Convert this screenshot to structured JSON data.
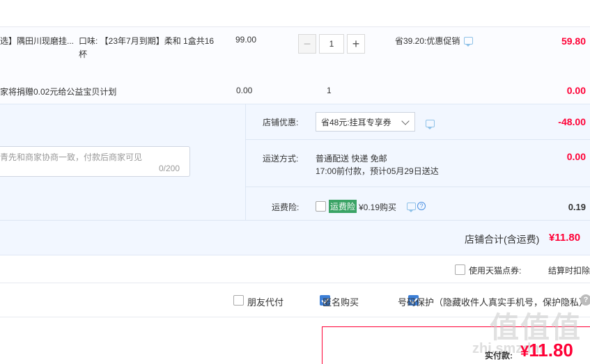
{
  "product": {
    "title": "选】隅田川现磨挂...",
    "flavor": "口味: 【23年7月到期】柔和 1盒共16杯",
    "price": "99.00",
    "quantity": "1",
    "promo": "省39.20:优惠促销",
    "subtotal": "59.80",
    "chat_icon": "chat-icon"
  },
  "donation": {
    "text": "家将捐赠0.02元给公益宝贝计划",
    "price": "0.00",
    "quantity": "1",
    "subtotal": "0.00"
  },
  "message": {
    "placeholder": "青先和商家协商一致，付款后商家可见",
    "count": "0/200"
  },
  "coupon": {
    "label": "店铺优惠:",
    "selected": "省48元:挂耳专享券",
    "amount": "-48.00"
  },
  "shipping": {
    "label": "运送方式:",
    "method": "普通配送 快递 免邮",
    "eta": "17:00前付款，预计05月29日送达",
    "amount": "0.00"
  },
  "insurance": {
    "label": "运费险:",
    "tag": "运费险",
    "text": "¥0.19购买",
    "amount": "0.19",
    "checked": false
  },
  "store_total": {
    "label": "店铺合计(含运费)",
    "amount": "¥11.80"
  },
  "tmall_voucher": {
    "label": "使用天猫点券:",
    "right_text": "结算时扣除",
    "checked": false
  },
  "options": {
    "friend_pay": {
      "label": "朋友代付",
      "checked": false
    },
    "anonymous": {
      "label": "匿名购买",
      "checked": true
    },
    "number_protect": {
      "label": "号码保护（隐藏收件人真实手机号，保护隐私）",
      "checked": true
    }
  },
  "payment": {
    "label": "实付款:",
    "currency": "¥",
    "amount": "11.80"
  },
  "watermark": {
    "logo": "值值值",
    "text": "zhi.smzdm"
  },
  "colors": {
    "accent": "#ff0036",
    "info_bg": "#f2f7ff",
    "checkbox_blue": "#3d7fd6",
    "tag_green": "#3aa365"
  }
}
